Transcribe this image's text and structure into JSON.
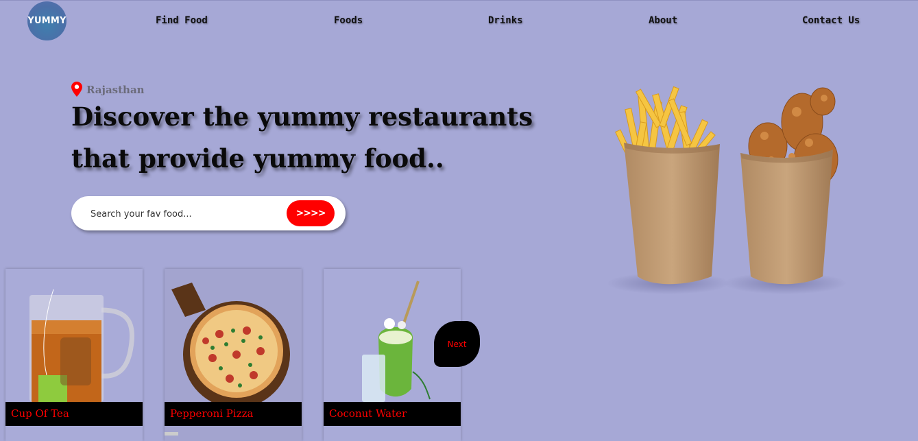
{
  "brand": {
    "logo_text": "YUMMY"
  },
  "nav": {
    "items": [
      "Find Food",
      "Foods",
      "Drinks",
      "About",
      "Contact Us"
    ]
  },
  "hero": {
    "location": "Rajasthan",
    "headline_line1": "Discover the yummy restaurants",
    "headline_line2": "that provide yummy food..",
    "search_placeholder": "Search your fav food...",
    "search_button": ">>>>"
  },
  "cards": [
    {
      "label": "Cup Of Tea"
    },
    {
      "label": "Pepperoni Pizza"
    },
    {
      "label": "Coconut Water"
    }
  ],
  "next_button": "Next",
  "colors": {
    "background": "#a6a8d6",
    "accent": "#ff0000",
    "label_bg": "#000000"
  }
}
